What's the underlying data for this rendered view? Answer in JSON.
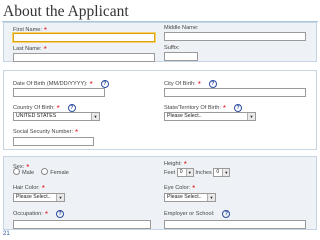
{
  "page": {
    "title": "About the Applicant",
    "page_number": "21"
  },
  "name": {
    "first_label": "First Name:",
    "middle_label": "Middle Name:",
    "last_label": "Last Name:",
    "suffix_label": "Suffix:"
  },
  "birth": {
    "dob_label": "Date Of Birth (MM/DD/YYYY):",
    "city_label": "City Of Birth:",
    "country_label": "Country Of Birth:",
    "country_value": "UNITED STATES",
    "state_label": "State/Territory Of Birth:",
    "state_value": "Please Select..",
    "ssn_label": "Social Security Number:"
  },
  "physical": {
    "sex_label": "Sex:",
    "male_label": "Male",
    "female_label": "Female",
    "height_label": "Height:",
    "feet_label": "Feet",
    "feet_value": "0",
    "inches_label": "Inches",
    "inches_value": "0",
    "hair_label": "Hair Color:",
    "hair_value": "Please Select..",
    "eye_label": "Eye Color:",
    "eye_value": "Please Select..",
    "occupation_label": "Occupation:",
    "employer_label": "Employer or School:"
  },
  "icons": {
    "required": "*",
    "help": "?",
    "dropdown": "▼"
  },
  "colors": {
    "required": "#e0101a",
    "help": "#2d4da0",
    "panel_shade": "#eef2f6",
    "focus": "#e0a20a"
  }
}
